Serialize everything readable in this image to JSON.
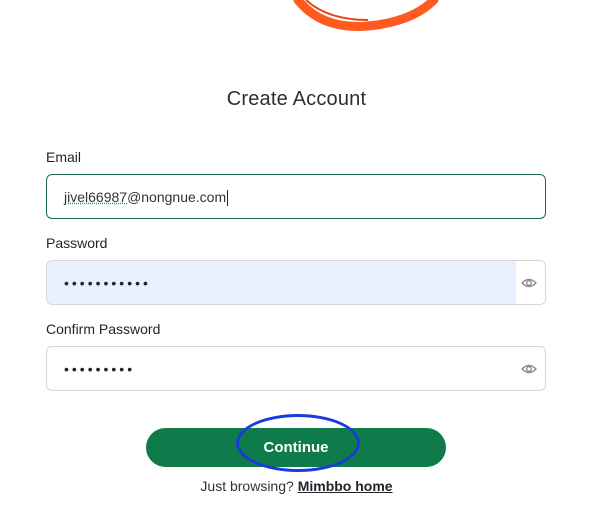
{
  "header": {
    "title": "Create Account"
  },
  "form": {
    "email": {
      "label": "Email",
      "value_name": "jivel66987",
      "value_domain": "@nongnue.com"
    },
    "password": {
      "label": "Password",
      "masked": "•••••••••••"
    },
    "confirm_password": {
      "label": "Confirm Password",
      "masked": "•••••••••"
    },
    "continue_label": "Continue"
  },
  "footer": {
    "prompt": "Just browsing?",
    "link": "Mimbbo home"
  },
  "colors": {
    "brand_orange": "#ff5a1f",
    "primary_green": "#0f7a4a",
    "annotation_blue": "#1a3bdb"
  }
}
